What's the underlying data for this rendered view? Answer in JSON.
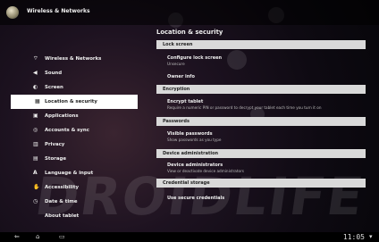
{
  "header": {
    "title": "Wireless & Networks"
  },
  "sidebar": {
    "items": [
      {
        "label": "Wireless & Networks",
        "icon": "wifi-icon"
      },
      {
        "label": "Sound",
        "icon": "speaker-icon"
      },
      {
        "label": "Screen",
        "icon": "screen-icon"
      },
      {
        "label": "Location & security",
        "icon": "location-grid-icon",
        "selected": true
      },
      {
        "label": "Applications",
        "icon": "applications-icon"
      },
      {
        "label": "Accounts & sync",
        "icon": "sync-icon"
      },
      {
        "label": "Privacy",
        "icon": "privacy-icon"
      },
      {
        "label": "Storage",
        "icon": "storage-icon"
      },
      {
        "label": "Language & input",
        "icon": "language-icon"
      },
      {
        "label": "Accessibility",
        "icon": "accessibility-icon"
      },
      {
        "label": "Date & time",
        "icon": "clock-icon"
      },
      {
        "label": "About tablet",
        "icon": ""
      }
    ]
  },
  "content": {
    "title": "Location & security",
    "sections": [
      {
        "label": "Lock screen"
      },
      {
        "label": "Encryption"
      },
      {
        "label": "Passwords"
      },
      {
        "label": "Device administration"
      },
      {
        "label": "Credential storage"
      }
    ],
    "entries": [
      {
        "title": "Configure lock screen",
        "subtitle": "Unsecure"
      },
      {
        "title": "Owner info",
        "subtitle": ""
      },
      {
        "title": "Encrypt tablet",
        "subtitle": "Require a numeric PIN or password to decrypt your tablet each time you turn it on"
      },
      {
        "title": "Visible passwords",
        "subtitle": "Show passwords as you type"
      },
      {
        "title": "Device administrators",
        "subtitle": "View or deactivate device administrators"
      },
      {
        "title": "Use secure credentials",
        "subtitle": ""
      }
    ]
  },
  "watermark": {
    "text": "DROIDLIFE"
  },
  "statusbar": {
    "time": "11:05"
  },
  "colors": {
    "selected_bg": "#ffffff",
    "section_bg": "#d9d9d9"
  }
}
